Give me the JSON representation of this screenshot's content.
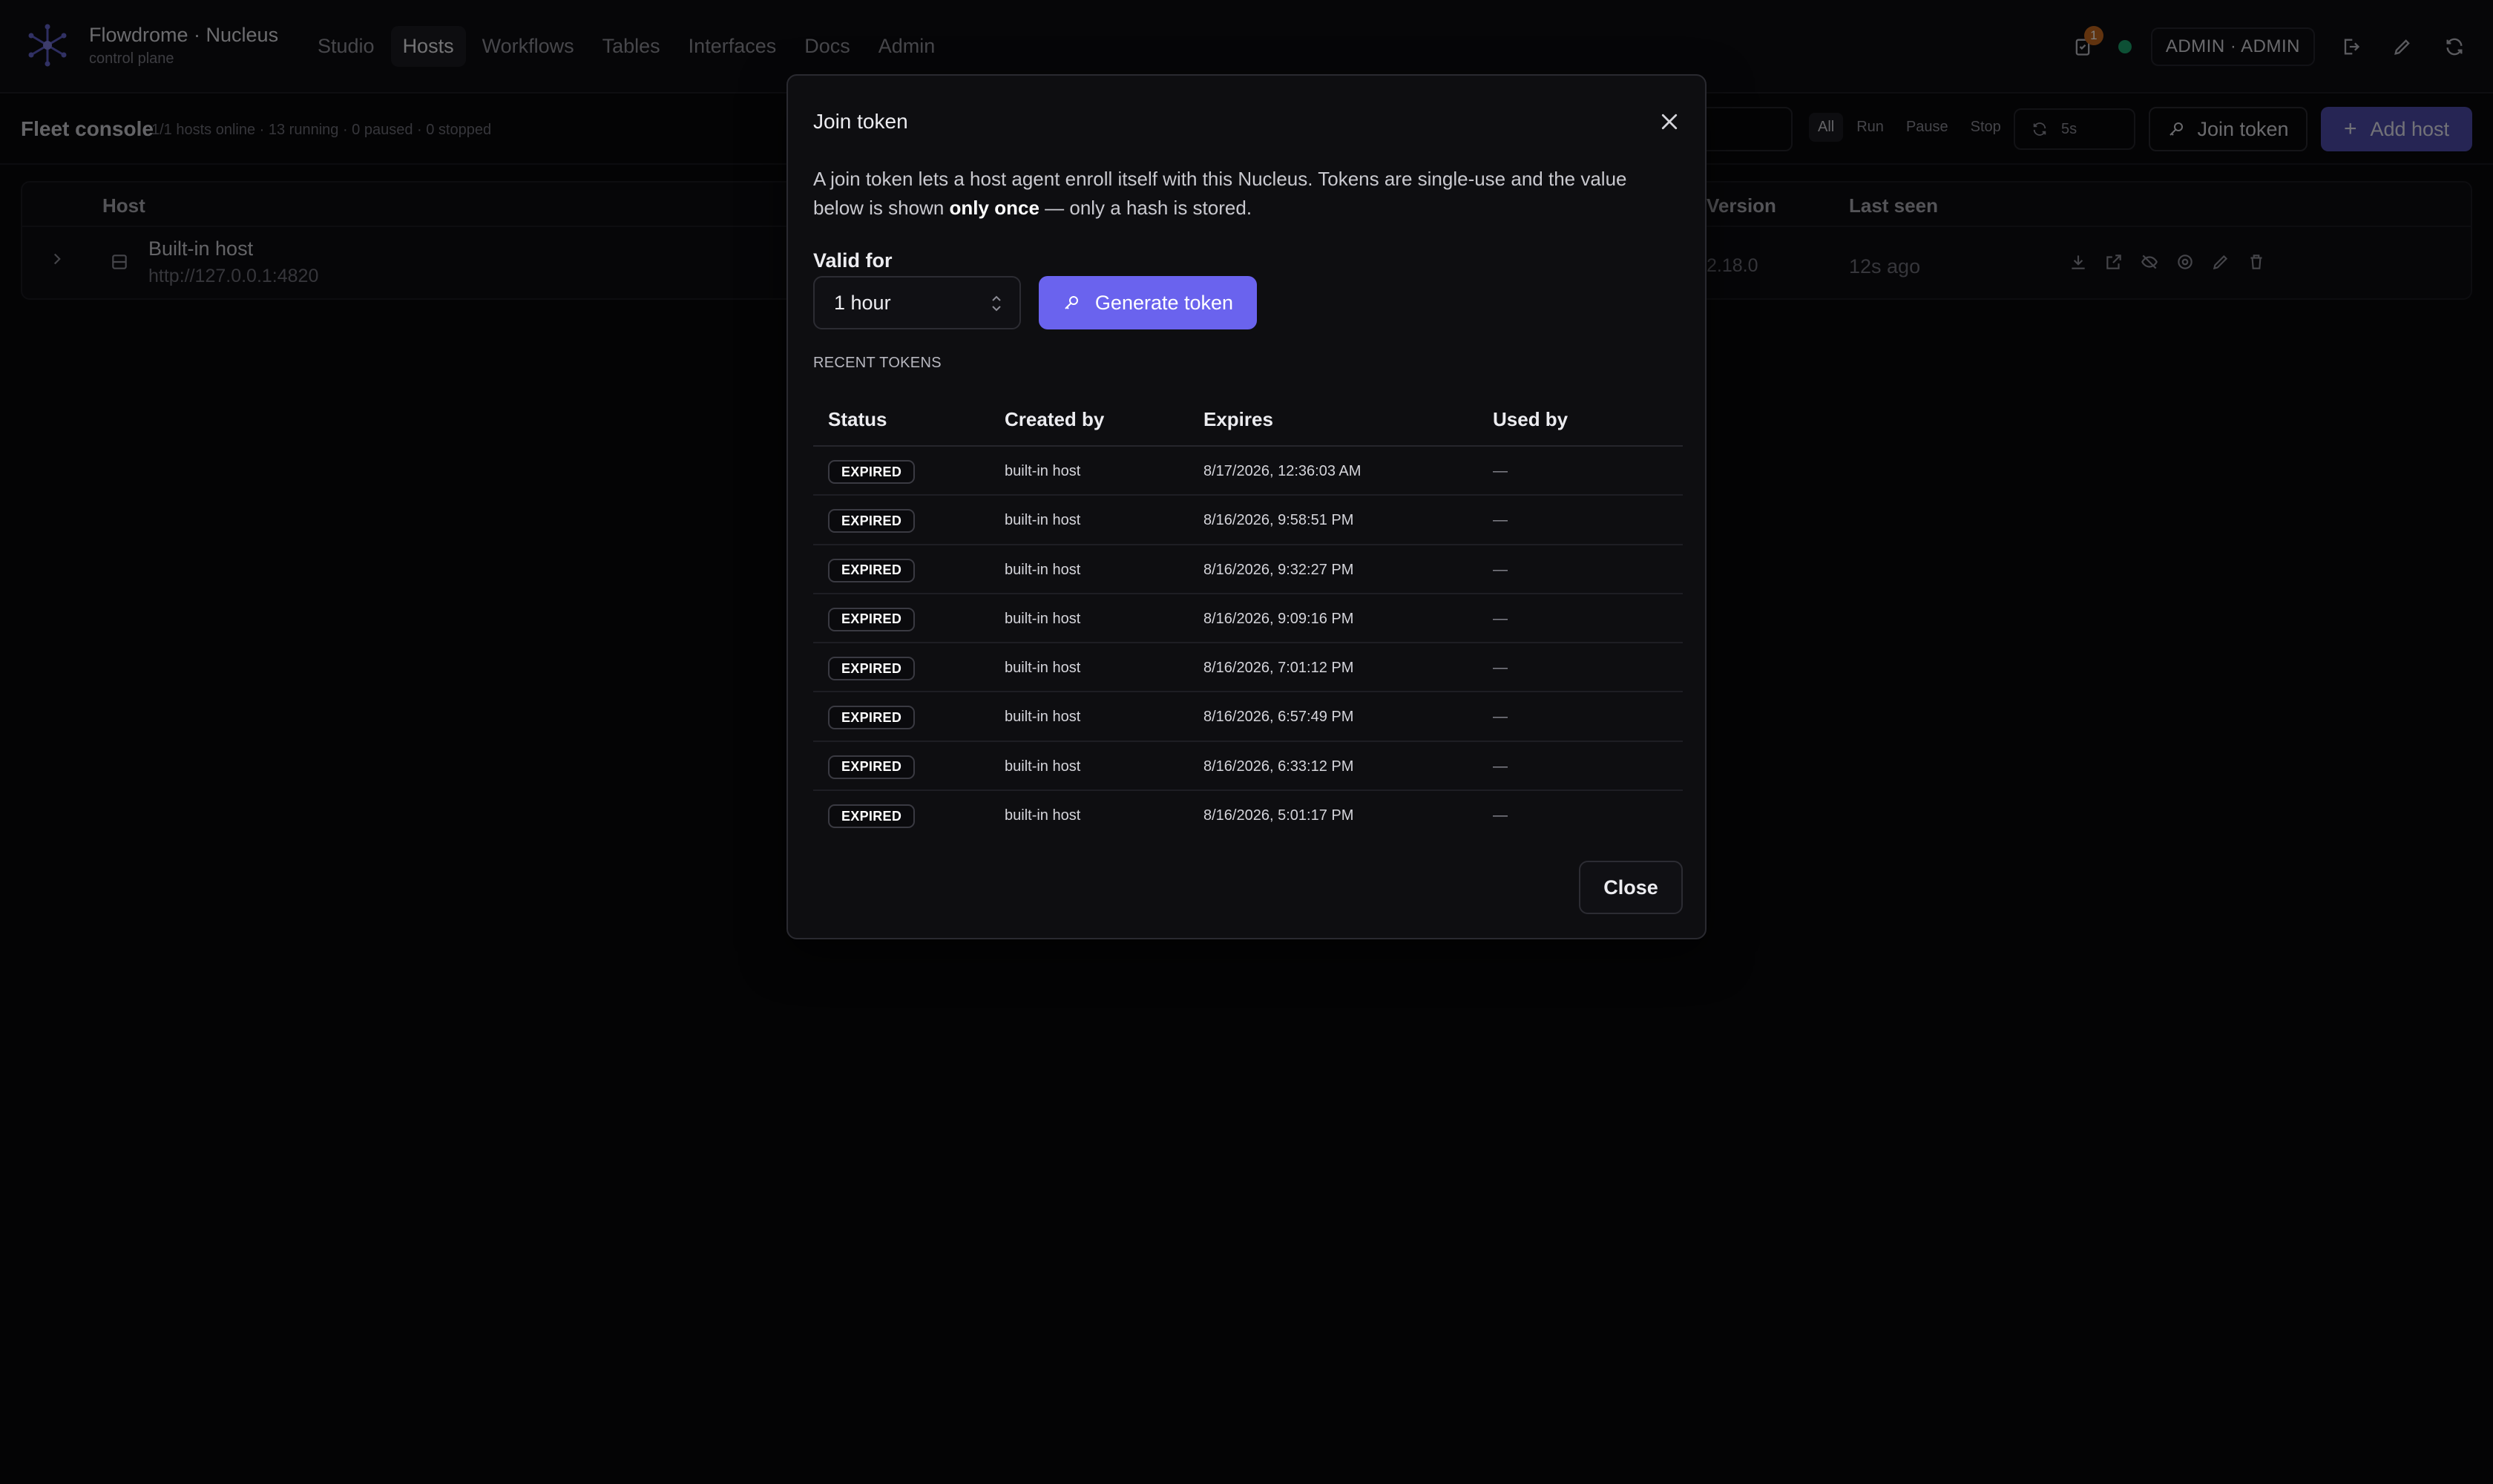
{
  "app": {
    "brand_title": "Flowdrome · Nucleus",
    "brand_subtitle": "control plane",
    "nav": [
      "Studio",
      "Hosts",
      "Workflows",
      "Tables",
      "Interfaces",
      "Docs",
      "Admin"
    ],
    "active_nav": "Hosts",
    "notification_count": "1",
    "status_color": "#1aa06a",
    "user_label": "ADMIN · ADMIN",
    "icons": [
      "tasks-icon",
      "logout-icon",
      "edit-icon",
      "refresh-icon"
    ]
  },
  "subbar": {
    "title": "Fleet console",
    "stats": "1/1 hosts online · 13 running · 0 paused · 0 stopped",
    "filters": [
      "All",
      "Run",
      "Pause",
      "Stop"
    ],
    "refresh_interval": "5s",
    "join_token_label": "Join token",
    "add_host_label": "Add host"
  },
  "hosts_table": {
    "columns": {
      "host": "Host",
      "version": "Version",
      "last_seen": "Last seen"
    },
    "visible_version_header": "Version",
    "rows": [
      {
        "name": "Built-in host",
        "url": "http://127.0.0.1:4820",
        "version": "2.18.0",
        "last_seen": "12s ago"
      }
    ],
    "row_action_icons": [
      "download-icon",
      "open-external-icon",
      "disable-icon",
      "settings-icon",
      "edit-icon",
      "delete-icon"
    ]
  },
  "modal": {
    "title": "Join token",
    "description_part1": "A join token lets a host agent enroll itself with this Nucleus. Tokens are single-use and the value below is shown ",
    "description_bold": "only once",
    "description_part2": " — only a hash is stored.",
    "valid_for_label": "Valid for",
    "valid_for_value": "1 hour",
    "generate_label": "Generate token",
    "recent_label": "RECENT TOKENS",
    "columns": {
      "status": "Status",
      "created_by": "Created by",
      "expires": "Expires",
      "used_by": "Used by"
    },
    "tokens": [
      {
        "status": "EXPIRED",
        "created_by": "built-in host",
        "expires": "8/17/2026, 12:36:03 AM",
        "used_by": "—"
      },
      {
        "status": "EXPIRED",
        "created_by": "built-in host",
        "expires": "8/16/2026, 9:58:51 PM",
        "used_by": "—"
      },
      {
        "status": "EXPIRED",
        "created_by": "built-in host",
        "expires": "8/16/2026, 9:32:27 PM",
        "used_by": "—"
      },
      {
        "status": "EXPIRED",
        "created_by": "built-in host",
        "expires": "8/16/2026, 9:09:16 PM",
        "used_by": "—"
      },
      {
        "status": "EXPIRED",
        "created_by": "built-in host",
        "expires": "8/16/2026, 7:01:12 PM",
        "used_by": "—"
      },
      {
        "status": "EXPIRED",
        "created_by": "built-in host",
        "expires": "8/16/2026, 6:57:49 PM",
        "used_by": "—"
      },
      {
        "status": "EXPIRED",
        "created_by": "built-in host",
        "expires": "8/16/2026, 6:33:12 PM",
        "used_by": "—"
      },
      {
        "status": "EXPIRED",
        "created_by": "built-in host",
        "expires": "8/16/2026, 5:01:17 PM",
        "used_by": "—"
      }
    ],
    "close_label": "Close"
  },
  "colors": {
    "accent": "#6a63ee",
    "background": "#08080b",
    "modal_background": "#0e0e11"
  }
}
